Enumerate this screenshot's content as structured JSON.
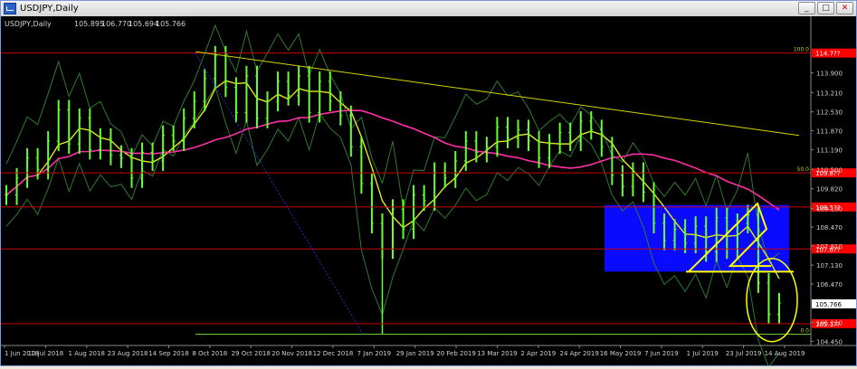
{
  "window": {
    "title": "USDJPY,Daily",
    "buttons": {
      "minimize": "_",
      "maximize": "□",
      "close": "✕"
    }
  },
  "colors": {
    "background": "#000000",
    "price_bars": "#66ff33",
    "ma_fast": "#e6e619",
    "ma_slow": "#ff2ea8",
    "bollinger": "#2f7a2f",
    "trendline": "#d4d400",
    "fib_lines": "#cc0000",
    "box": "#0a0aff",
    "pattern_lines": "#ffff00",
    "axis_text": "#d0d0d0",
    "red_label": "#ff0000"
  },
  "chart_data": {
    "type": "line",
    "title": "USDJPY,Daily",
    "ohlc_header": {
      "label": "USDJPY,Daily",
      "open": "105.895",
      "high": "106.770",
      "low": "105.694",
      "close": "105.766"
    },
    "ylim": [
      104.3,
      115.45
    ],
    "y_ticks": [
      "113.900",
      "113.210",
      "112.530",
      "111.870",
      "111.190",
      "110.500",
      "109.820",
      "109.130",
      "108.470",
      "107.810",
      "107.130",
      "106.470",
      "105.766",
      "105.110",
      "104.450"
    ],
    "x_ticks": [
      "1 Jun 2018",
      "10 Jul 2018",
      "1 Aug 2018",
      "23 Aug 2018",
      "14 Sep 2018",
      "8 Oct 2018",
      "29 Oct 2018",
      "20 Nov 2018",
      "12 Dec 2018",
      "7 Jan 2019",
      "29 Jan 2019",
      "20 Feb 2019",
      "13 Mar 2019",
      "2 Apr 2019",
      "24 Apr 2019",
      "16 May 2019",
      "7 Jun 2019",
      "1 Jul 2019",
      "23 Jul 2019",
      "14 Aug 2019"
    ],
    "fib_levels": [
      {
        "pct": "100.0",
        "price": 114.6,
        "label": "114.7??"
      },
      {
        "pct": "",
        "price": 109.18,
        "label": "109.5??"
      },
      {
        "pct": "50.0",
        "price": 110.38,
        "label": "109.8??"
      },
      {
        "pct": "",
        "price": 107.7,
        "label": "107.6??"
      },
      {
        "pct": "",
        "price": 105.07,
        "label": "105.1??"
      },
      {
        "pct": "0.0",
        "price": 104.7,
        "label": ""
      }
    ],
    "current_price": "105.766",
    "close_series": {
      "name": "USDJPY close",
      "values": [
        109.6,
        110.2,
        110.9,
        110.5,
        111.5,
        112.6,
        111.4,
        112.3,
        111.2,
        111.6,
        111.0,
        110.9,
        110.2,
        111.1,
        110.8,
        111.7,
        111.5,
        112.3,
        112.9,
        113.7,
        114.5,
        113.4,
        112.5,
        113.8,
        112.3,
        112.9,
        113.6,
        113.1,
        113.8,
        112.5,
        113.6,
        112.9,
        112.4,
        111.3,
        110.0,
        108.6,
        107.7,
        109.1,
        108.4,
        109.6,
        109.4,
        110.4,
        110.2,
        110.8,
        111.5,
        111.1,
        111.3,
        112.0,
        111.6,
        111.9,
        111.5,
        110.9,
        111.4,
        111.8,
        111.5,
        112.2,
        111.9,
        111.3,
        110.3,
        109.9,
        110.4,
        109.7,
        108.6,
        108.0,
        108.4,
        107.9,
        108.5,
        107.6,
        108.8,
        107.7,
        108.6,
        108.9,
        106.5,
        105.4,
        105.8
      ]
    },
    "annotations": [
      "blue consolidation box May–Aug 2019",
      "downward trendline from Oct 2018 high",
      "yellow ellipse around Aug 2019 drop"
    ]
  }
}
